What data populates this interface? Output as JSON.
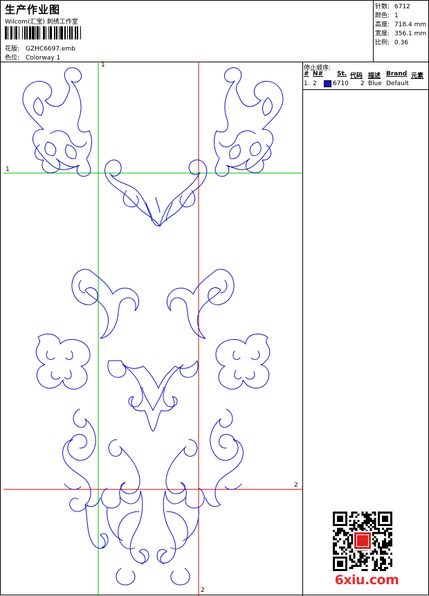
{
  "header": {
    "title": "生产作业图",
    "company": "Wilcom(汇宝) 刺绣工作室",
    "design_label": "花版:",
    "design_value": "GZHC6697.emb",
    "colorway_label": "色位:",
    "colorway_value": "Colorway 1"
  },
  "specs": {
    "stitches_label": "针数:",
    "stitches_value": "6712",
    "colors_label": "颜色:",
    "colors_value": "1",
    "height_label": "高度:",
    "height_value": "718.4 mm",
    "width_label": "宽度:",
    "width_value": "356.1 mm",
    "scale_label": "比例:",
    "scale_value": "0.36"
  },
  "stop_sequence": {
    "title": "停止顺序:",
    "columns": [
      "#",
      "N#",
      "St.",
      "代码",
      "描述",
      "Brand",
      "元素"
    ],
    "rows": [
      {
        "index": "1.",
        "needle": "2",
        "stitches": "6710",
        "code": "2",
        "description": "Blue",
        "brand": "Default",
        "swatch_color": "#1414c8"
      }
    ]
  },
  "guides": {
    "green_label_top": "1",
    "green_label_left": "1",
    "red_label_right": "2",
    "red_label_bottom": "2"
  },
  "colors": {
    "outline": "#1010c0",
    "guide_green": "#00c000",
    "guide_red": "#e00000",
    "logo": "#e42d2d"
  },
  "logo": {
    "text": "6xiu.com"
  }
}
